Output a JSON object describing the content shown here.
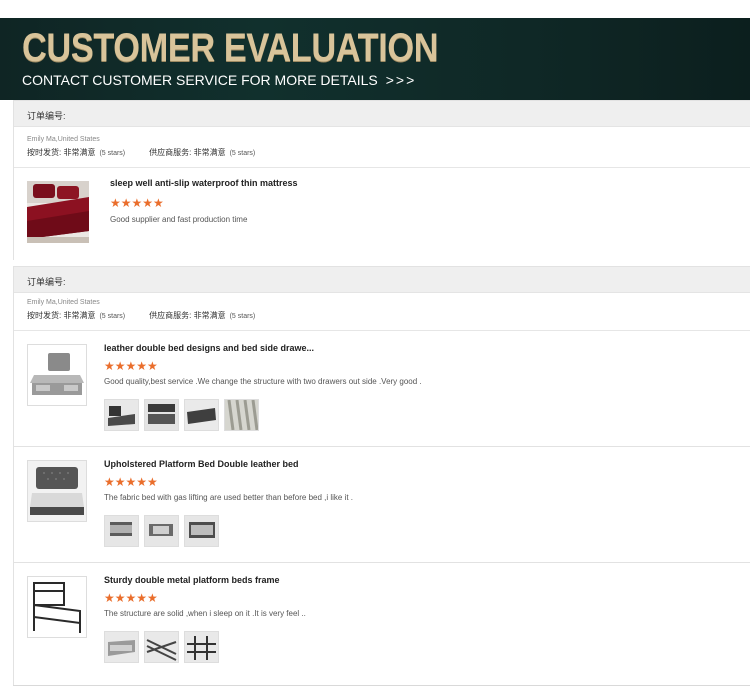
{
  "banner": {
    "title": "CUSTOMER EVALUATION",
    "subtitle": "CONTACT CUSTOMER SERVICE FOR MORE DETAILS",
    "arrows": ">>>"
  },
  "reviews": [
    {
      "order_label": "订单编号:",
      "customer": "Emily Ma,United States",
      "delivery_label": "按时发货: 非常满意",
      "delivery_stars": "(5 stars)",
      "supplier_label": "供应商服务: 非常满意",
      "supplier_stars": "(5 stars)",
      "items": [
        {
          "title": "sleep well anti-slip waterproof thin mattress",
          "stars": "★★★★★",
          "text": "Good supplier and fast production time"
        }
      ]
    },
    {
      "order_label": "订单编号:",
      "customer": "Emily Ma,United States",
      "delivery_label": "按时发货: 非常满意",
      "delivery_stars": "(5 stars)",
      "supplier_label": "供应商服务: 非常满意",
      "supplier_stars": "(5 stars)",
      "items": [
        {
          "title": "leather double bed designs and bed side drawe...",
          "stars": "★★★★★",
          "text": "Good quality,best service .We change the structure with two drawers out side .Very good ."
        },
        {
          "title": "Upholstered Platform Bed Double leather bed",
          "stars": "★★★★★",
          "text": "The fabric bed with gas lifting are used better than before bed ,i like it ."
        },
        {
          "title": "Sturdy double metal platform beds frame",
          "stars": "★★★★★",
          "text": "The structure are solid ,when i sleep on it .It is very feel .."
        }
      ]
    }
  ],
  "colors": {
    "banner_bg": "#0f2826",
    "title_gold": "#d9c49a",
    "star": "#ea6e2c"
  }
}
